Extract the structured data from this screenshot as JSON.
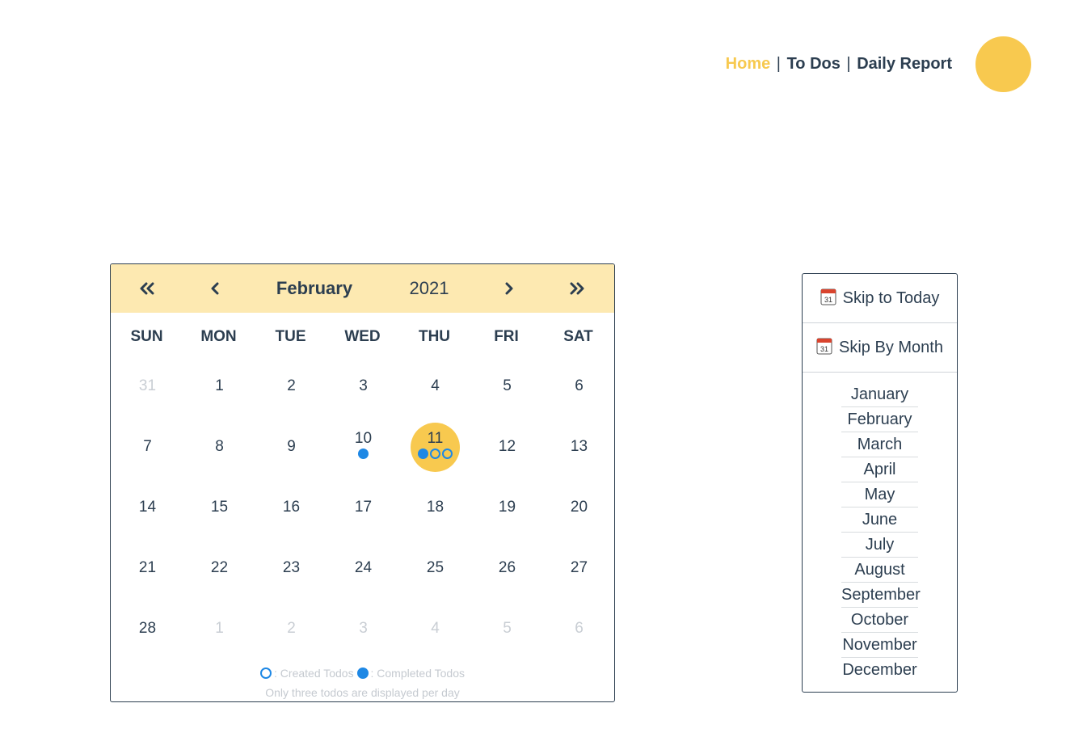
{
  "nav": {
    "home": "Home",
    "separator": "|",
    "todos": "To Dos",
    "daily_report": "Daily Report"
  },
  "calendar": {
    "prev_year_icon": "double-chevron-left-icon",
    "prev_month_icon": "chevron-left-icon",
    "next_month_icon": "chevron-right-icon",
    "next_year_icon": "double-chevron-right-icon",
    "month": "February",
    "year": "2021",
    "weekdays": [
      "SUN",
      "MON",
      "TUE",
      "WED",
      "THU",
      "FRI",
      "SAT"
    ],
    "weeks": [
      [
        {
          "d": "31",
          "muted": true
        },
        {
          "d": "1"
        },
        {
          "d": "2"
        },
        {
          "d": "3"
        },
        {
          "d": "4"
        },
        {
          "d": "5"
        },
        {
          "d": "6"
        }
      ],
      [
        {
          "d": "7"
        },
        {
          "d": "8"
        },
        {
          "d": "9"
        },
        {
          "d": "10",
          "dots": [
            "completed"
          ]
        },
        {
          "d": "11",
          "selected": true,
          "dots": [
            "completed",
            "created",
            "created"
          ]
        },
        {
          "d": "12"
        },
        {
          "d": "13"
        }
      ],
      [
        {
          "d": "14"
        },
        {
          "d": "15"
        },
        {
          "d": "16"
        },
        {
          "d": "17"
        },
        {
          "d": "18"
        },
        {
          "d": "19"
        },
        {
          "d": "20"
        }
      ],
      [
        {
          "d": "21"
        },
        {
          "d": "22"
        },
        {
          "d": "23"
        },
        {
          "d": "24"
        },
        {
          "d": "25"
        },
        {
          "d": "26"
        },
        {
          "d": "27"
        }
      ],
      [
        {
          "d": "28"
        },
        {
          "d": "1",
          "muted": true
        },
        {
          "d": "2",
          "muted": true
        },
        {
          "d": "3",
          "muted": true
        },
        {
          "d": "4",
          "muted": true
        },
        {
          "d": "5",
          "muted": true
        },
        {
          "d": "6",
          "muted": true
        }
      ]
    ],
    "legend_created": ": Created Todos",
    "legend_completed": ": Completed Todos",
    "note": "Only three todos are displayed per day"
  },
  "skip": {
    "today_label": "Skip to Today",
    "by_month_label": "Skip By Month",
    "months": [
      "January",
      "February",
      "March",
      "April",
      "May",
      "June",
      "July",
      "August",
      "September",
      "October",
      "November",
      "December"
    ]
  },
  "colors": {
    "accent": "#f8c94f",
    "header_bg": "#fde9b1",
    "text": "#2c3e50",
    "dot": "#1e88e5",
    "muted": "#c9ced4"
  }
}
